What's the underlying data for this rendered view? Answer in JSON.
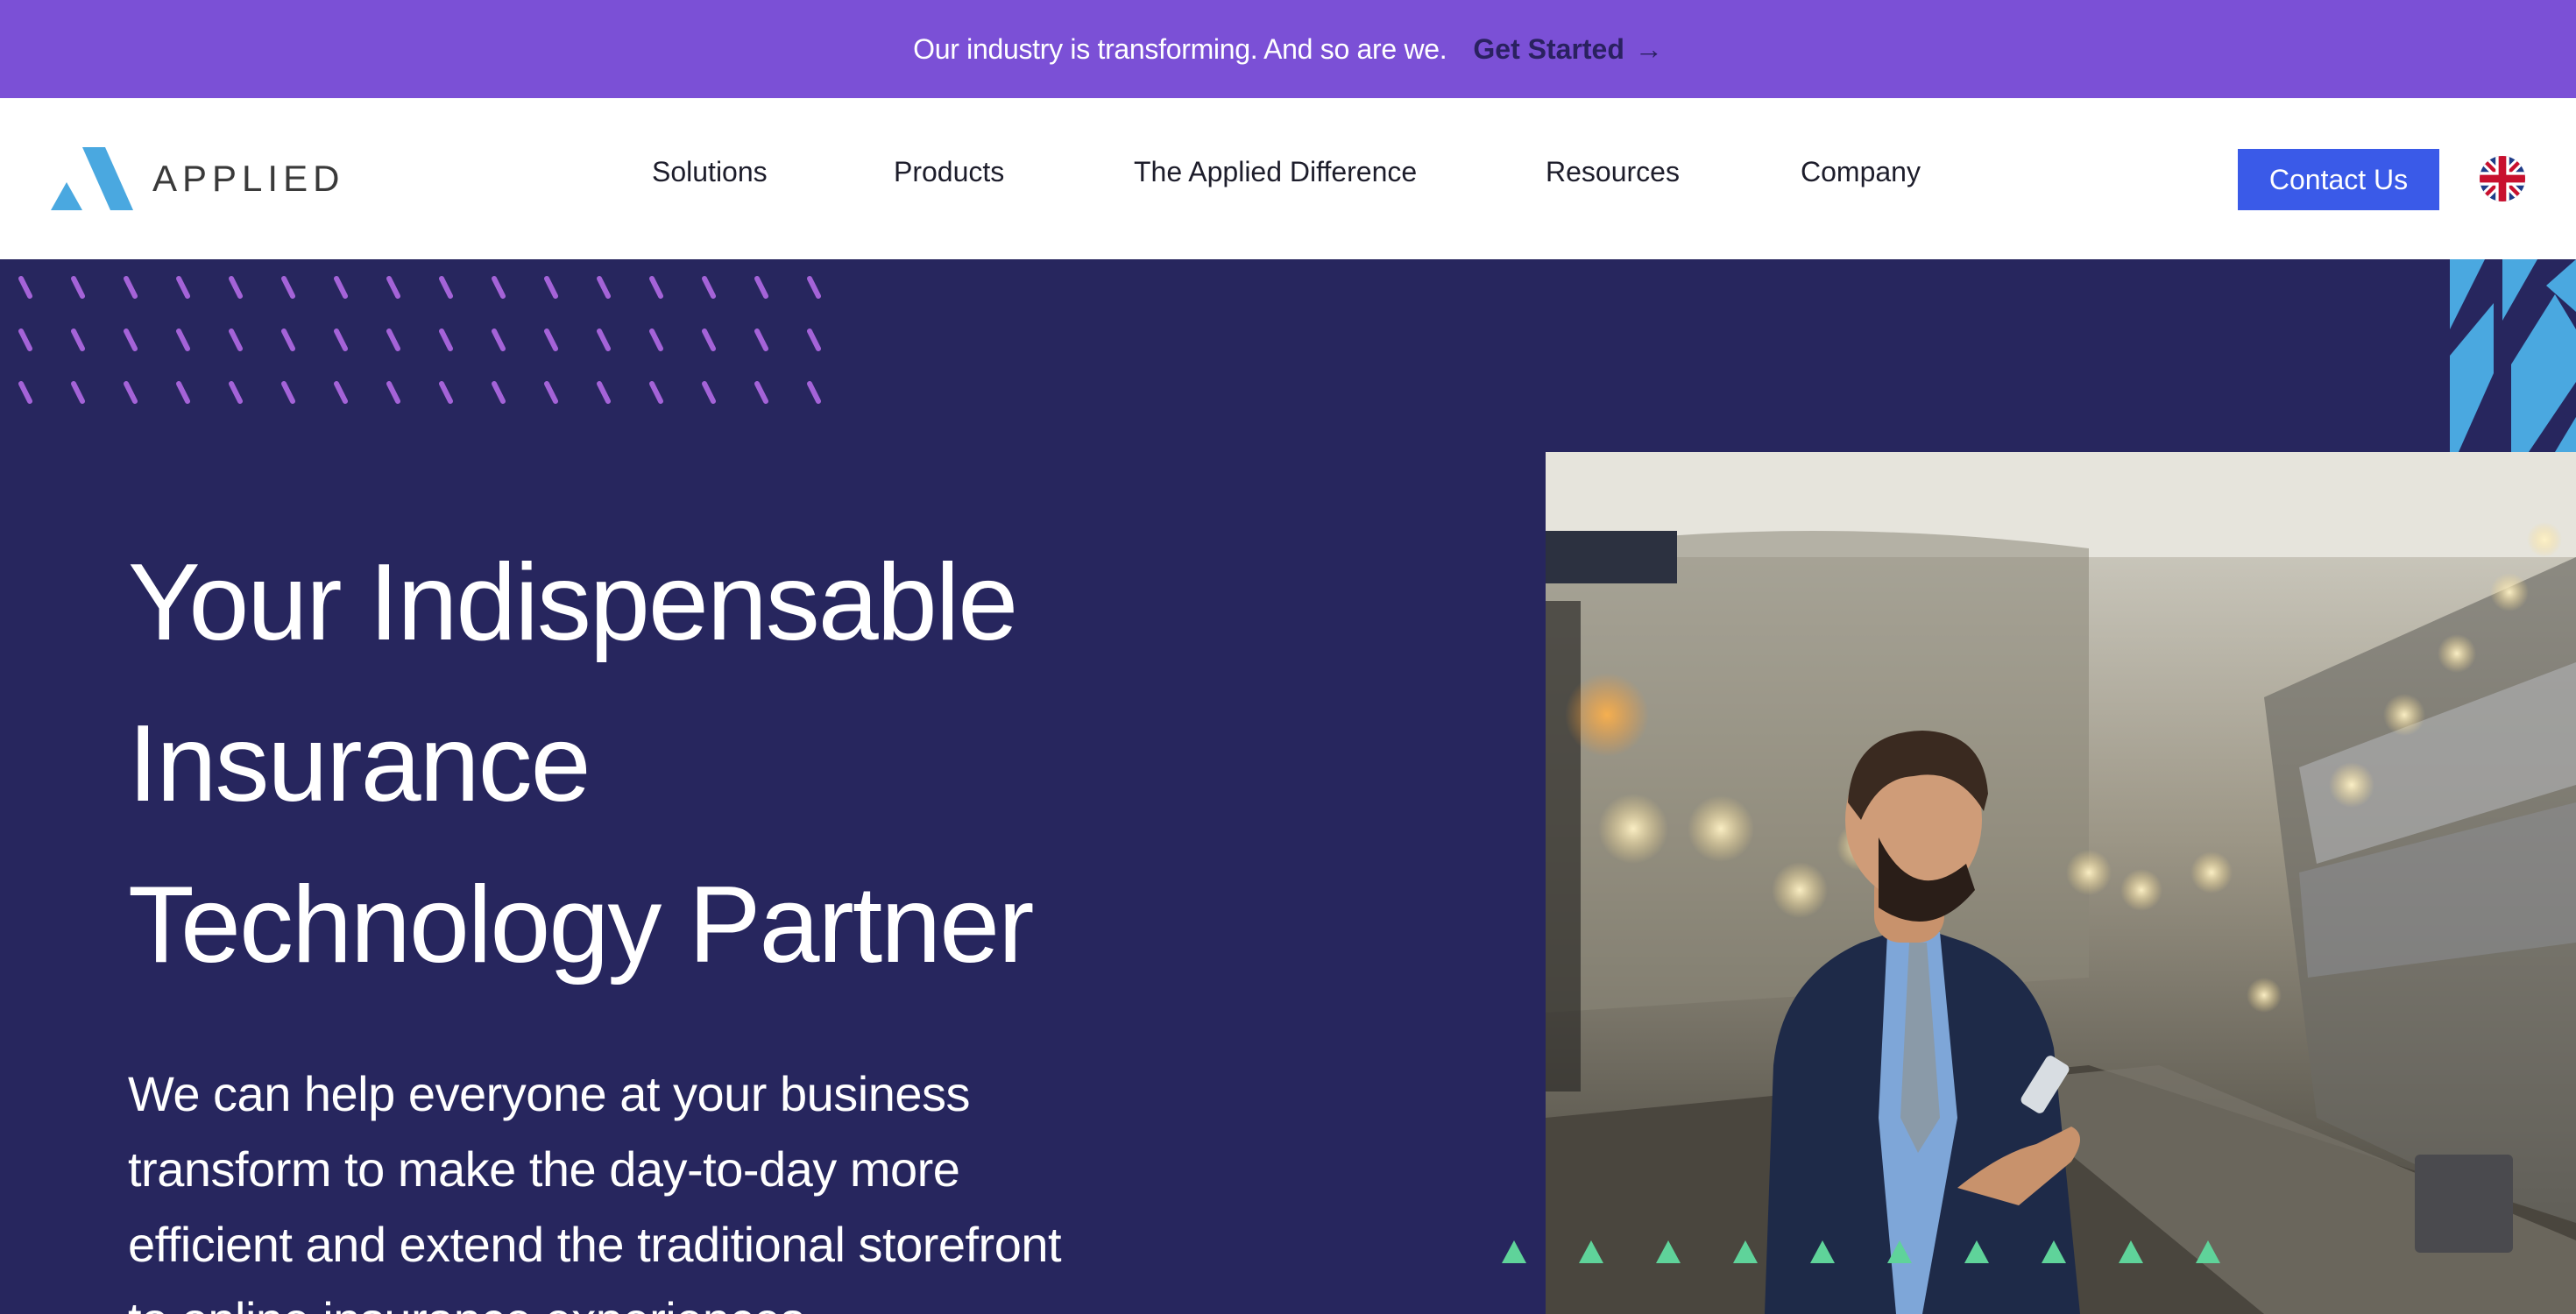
{
  "announcement": {
    "text": "Our industry is transforming. And so are we.",
    "link_label": "Get Started",
    "link_icon": "arrow-right-icon"
  },
  "header": {
    "logo_text": "APPLIED",
    "nav": [
      {
        "label": "Solutions"
      },
      {
        "label": "Products"
      },
      {
        "label": "The Applied Difference"
      },
      {
        "label": "Resources"
      },
      {
        "label": "Company"
      }
    ],
    "contact_label": "Contact Us",
    "language_icon": "uk-flag-icon"
  },
  "hero": {
    "title_lines": [
      "Your Indispensable",
      "Insurance",
      "Technology Partner"
    ],
    "subtitle_lines": [
      "We can help everyone at your business",
      "transform to make the day-to-day more",
      "efficient and extend the traditional storefront",
      "to online insurance experiences."
    ]
  },
  "colors": {
    "announcement_bg": "#7b50d6",
    "hero_bg": "#27265e",
    "accent_blue": "#3a5ae8",
    "logo_blue": "#4aa8e0",
    "dash_purple": "#a463d8",
    "triangle_green": "#5fd39a"
  }
}
